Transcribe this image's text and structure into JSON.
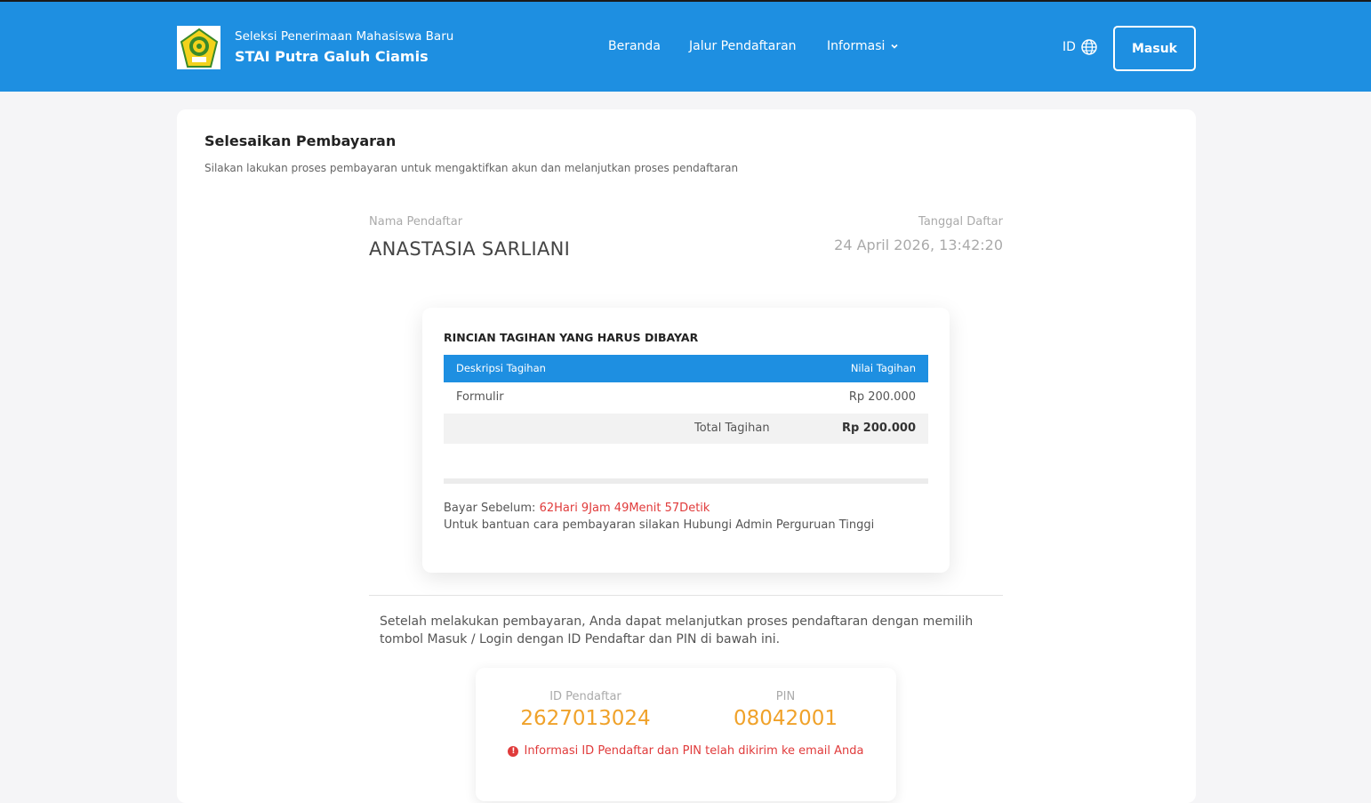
{
  "header": {
    "brand_subtitle": "Seleksi Penerimaan Mahasiswa Baru",
    "brand_title": "STAI Putra Galuh Ciamis",
    "logo_icon": "campus-emblem-icon",
    "nav": {
      "beranda": "Beranda",
      "jalur": "Jalur Pendaftaran",
      "informasi": "Informasi"
    },
    "lang_label": "ID",
    "lang_icon": "globe-icon",
    "login_button": "Masuk",
    "bg_color": "#1e8fe1"
  },
  "page": {
    "title": "Selesaikan Pembayaran",
    "subtitle": "Silakan lakukan proses pembayaran untuk mengaktifkan akun dan melanjutkan proses pendaftaran"
  },
  "registrant": {
    "name_label": "Nama Pendaftar",
    "name": "ANASTASIA SARLIANI",
    "date_label": "Tanggal Daftar",
    "date": "24 April 2026, 13:42:20"
  },
  "bill": {
    "heading": "RINCIAN TAGIHAN YANG HARUS DIBAYAR",
    "columns": [
      "Deskripsi Tagihan",
      "Nilai Tagihan"
    ],
    "rows": [
      {
        "description": "Formulir",
        "amount": "Rp 200.000"
      }
    ],
    "total_label": "Total Tagihan",
    "total_value": "Rp 200.000",
    "due_label": "Bayar Sebelum:",
    "due_countdown": "62Hari 9Jam 49Menit 57Detik",
    "help_text": "Untuk bantuan cara pembayaran silakan Hubungi Admin Perguruan Tinggi"
  },
  "after_payment": {
    "text": "Setelah melakukan pembayaran, Anda dapat melanjutkan proses pendaftaran dengan memilih tombol Masuk / Login dengan ID Pendaftar dan PIN di bawah ini."
  },
  "credentials": {
    "id_label": "ID Pendaftar",
    "id_value": "2627013024",
    "pin_label": "PIN",
    "pin_value": "08042001",
    "note": "Informasi ID Pendaftar dan PIN telah dikirim ke email Anda",
    "note_icon": "alert-icon",
    "accent_color": "#f0a22a",
    "alert_color": "#e03b3b"
  }
}
